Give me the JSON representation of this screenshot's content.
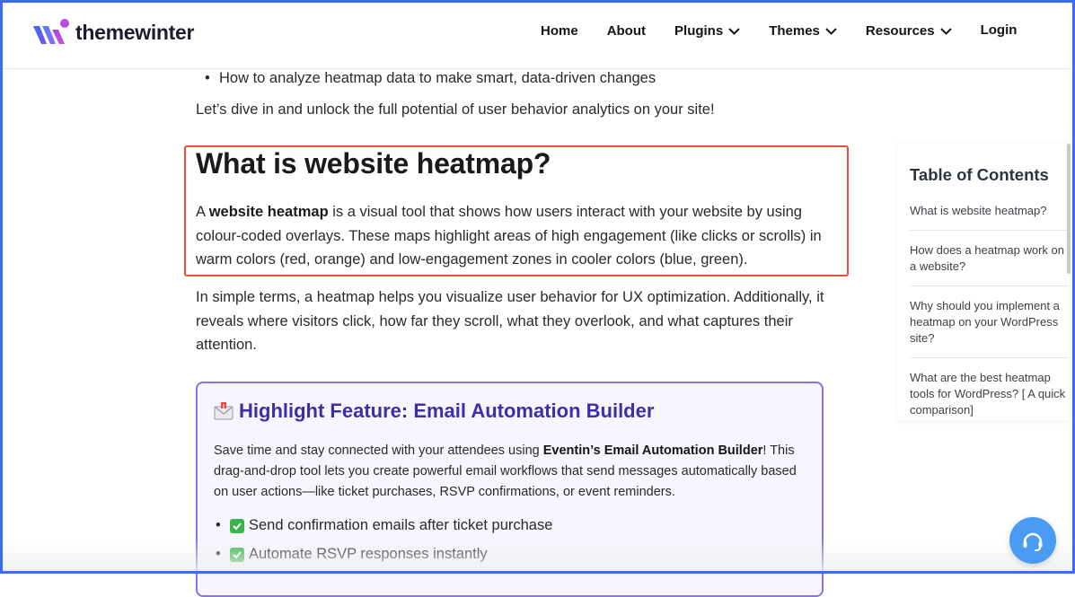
{
  "brand": {
    "name": "themewinter"
  },
  "nav": {
    "home": "Home",
    "about": "About",
    "plugins": "Plugins",
    "themes": "Themes",
    "resources": "Resources",
    "login": "Login"
  },
  "article": {
    "bullet_top": "How to analyze heatmap data to make smart, data-driven changes",
    "intro": "Let’s dive in and unlock the full potential of user behavior analytics on your site!",
    "heading": "What is website heatmap?",
    "def_a": "A ",
    "def_bold": "website heatmap",
    "def_rest": " is a visual tool that shows how users interact with your website by using colour-coded overlays. These maps highlight areas of high engagement (like clicks or scrolls) in warm colors (red, orange) and low-engagement zones in cooler colors (blue, green).",
    "simple": "In simple terms, a heatmap helps you visualize user behavior for UX optimization. Additionally, it reveals where visitors click, how far they scroll, what they overlook, and what captures their attention."
  },
  "feature": {
    "title": "Highlight Feature: Email Automation Builder",
    "p_start": "Save time and stay connected with your attendees using ",
    "p_bold": "Eventin’s Email Automation Builder",
    "p_end": "! This drag-and-drop tool lets you create powerful email workflows that send messages automatically based on user actions—like ticket purchases, RSVP confirmations, or event reminders.",
    "items": [
      "Send confirmation emails after ticket purchase",
      "Automate RSVP responses instantly"
    ]
  },
  "toc": {
    "title": "Table of Contents",
    "items": [
      "What is website heatmap?",
      "How does a heatmap work on a website?",
      "Why should you implement a heatmap on your WordPress site?",
      "What are the best heatmap tools for WordPress? [ A quick comparison]"
    ]
  },
  "colors": {
    "accent": "#3a6cf4",
    "highlight_border": "#e0533a",
    "feature_border": "#8a73e0",
    "feature_title": "#3d2fa8",
    "chat_button": "#4b9bf5"
  }
}
